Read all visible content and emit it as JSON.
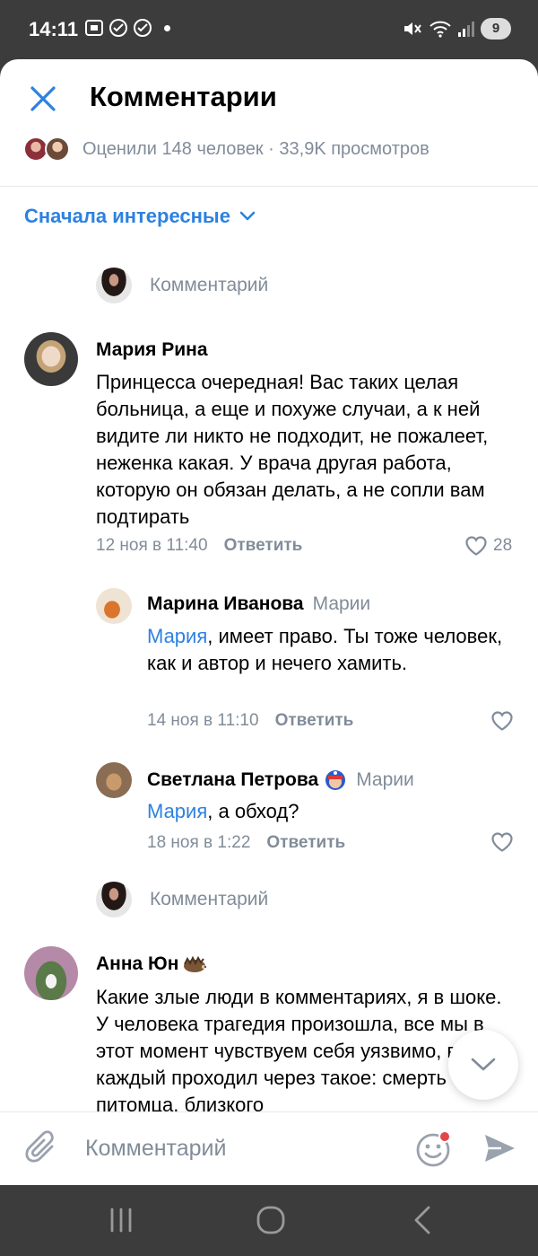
{
  "status_bar": {
    "time": "14:11",
    "battery": "9"
  },
  "header": {
    "title": "Комментарии",
    "stats": "Оценили 148 человек · 33,9K просмотров"
  },
  "sort": {
    "label": "Сначала интересные"
  },
  "reply_placeholder": "Комментарий",
  "comments": [
    {
      "author": "Мария Рина",
      "text": "Принцесса очередная! Вас таких целая больница, а еще и похуже случаи, а к ней видите ли никто не подходит, не пожалеет, неженка какая. У врача другая работа, которую он обязан делать, а не сопли вам подтирать",
      "date": "12 ноя в 11:40",
      "reply_label": "Ответить",
      "likes": "28",
      "replies": [
        {
          "author": "Марина Иванова",
          "to": "Марии",
          "mention": "Мария",
          "text": ", имеет право. Ты тоже человек, как и автор и нечего хамить.",
          "date": "14 ноя в 11:10",
          "reply_label": "Ответить"
        },
        {
          "author": "Светлана Петрова",
          "to": "Марии",
          "mention": "Мария",
          "text": ", а обход?",
          "date": "18 ноя в 1:22",
          "reply_label": "Ответить"
        }
      ]
    },
    {
      "author": "Анна Юн",
      "text": "Какие злые люди в комментариях, я в шоке. У человека трагедия произошла, все мы в этот момент чувствуем себя уязвимо, ведь каждый проходил через такое: смерть питомца, близкого"
    }
  ],
  "composer": {
    "placeholder": "Комментарий"
  },
  "colors": {
    "accent": "#2d81e0",
    "secondary": "#818c99",
    "notification": "#e64646"
  },
  "icons": [
    "close-icon",
    "chevron-down-icon",
    "heart-icon",
    "paperclip-icon",
    "smile-icon",
    "send-icon",
    "recents-icon",
    "home-icon",
    "back-icon",
    "hedgehog-emoji-icon",
    "captain-badge-icon"
  ]
}
